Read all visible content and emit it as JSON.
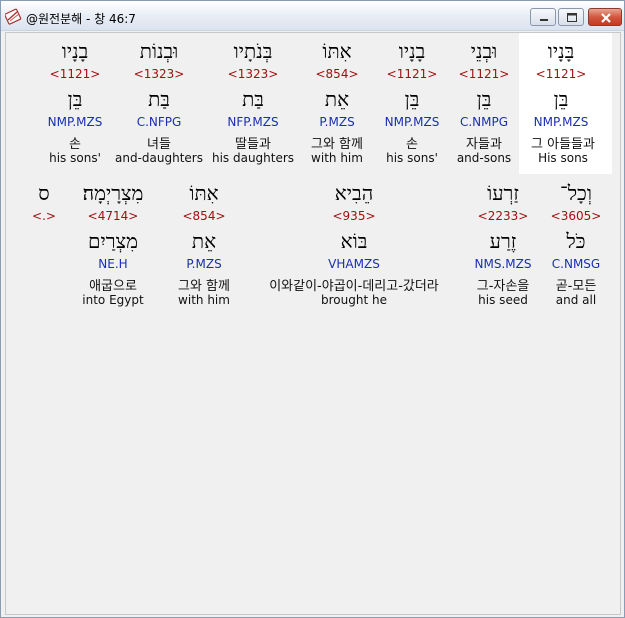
{
  "window": {
    "title": "@원전분해 - 창 46:7",
    "icon": "bible-app-icon",
    "accent_close": "#c23a22"
  },
  "rows": [
    {
      "words": [
        {
          "hebrew": "בָּנָיו",
          "strong": "<1121>",
          "lemma": "בֵּן",
          "morph": "NMP.MZS",
          "korean": "그 아들들과",
          "english": "His sons",
          "highlight": true
        },
        {
          "hebrew": "וּבְנֵי",
          "strong": "<1121>",
          "lemma": "בֵּן",
          "morph": "C.NMPG",
          "korean": "자들과",
          "english": "and-sons"
        },
        {
          "hebrew": "בָנָיו",
          "strong": "<1121>",
          "lemma": "בֵּן",
          "morph": "NMP.MZS",
          "korean": "손",
          "english": "his sons'"
        },
        {
          "hebrew": "אִתּוֹ",
          "strong": "<854>",
          "lemma": "אֵת",
          "morph": "P.MZS",
          "korean": "그와 함께",
          "english": "with him"
        },
        {
          "hebrew": "בְּנֹתָיו",
          "strong": "<1323>",
          "lemma": "בַּת",
          "morph": "NFP.MZS",
          "korean": "딸들과",
          "english": "his daughters"
        },
        {
          "hebrew": "וּבְנוֹת",
          "strong": "<1323>",
          "lemma": "בַּת",
          "morph": "C.NFPG",
          "korean": "녀들",
          "english": "and-daughters"
        },
        {
          "hebrew": "בָנָיו",
          "strong": "<1121>",
          "lemma": "בֵּן",
          "morph": "NMP.MZS",
          "korean": "손",
          "english": "his sons'"
        }
      ]
    },
    {
      "words": [
        {
          "hebrew": "וְכָל־",
          "strong": "<3605>",
          "lemma": "כֹּל",
          "morph": "C.NMSG",
          "korean": "곧-모든",
          "english": "and all"
        },
        {
          "hebrew": "זַרְעוֹ",
          "strong": "<2233>",
          "lemma": "זֶרַע",
          "morph": "NMS.MZS",
          "korean": "그-자손을",
          "english": "his seed"
        },
        {
          "hebrew": "הֵבִיא",
          "strong": "<935>",
          "lemma": "בּוֹא",
          "morph": "VHAMZS",
          "korean": "이와같이-야곱이-데리고-갔더라",
          "english": "brought he"
        },
        {
          "hebrew": "אִתּוֹ",
          "strong": "<854>",
          "lemma": "אֵת",
          "morph": "P.MZS",
          "korean": "그와 함께",
          "english": "with him"
        },
        {
          "hebrew": "מִצְרָיְמָה׃",
          "strong": "<4714>",
          "lemma": "מִצְרַיִם",
          "morph": "NE.H",
          "korean": "애굽으로",
          "english": "into Egypt"
        },
        {
          "hebrew": "ס",
          "strong": "<.>",
          "lemma": "",
          "morph": "",
          "korean": "",
          "english": ""
        }
      ]
    }
  ]
}
